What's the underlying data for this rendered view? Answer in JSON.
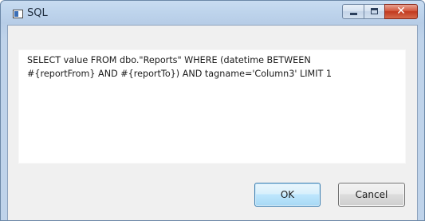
{
  "window": {
    "title": "SQL"
  },
  "editor": {
    "sql_text": "SELECT value FROM dbo.\"Reports\" WHERE (datetime BETWEEN\n#{reportFrom} AND #{reportTo}) AND tagname='Column3' LIMIT 1"
  },
  "buttons": {
    "ok_label": "OK",
    "cancel_label": "Cancel"
  },
  "icons": {
    "app": "window-icon",
    "minimize": "minimize-icon",
    "maximize": "maximize-icon",
    "close": "close-icon"
  },
  "colors": {
    "titlebar": "#bfd3ea",
    "close_button": "#c2391f",
    "ok_button_border": "#3c7fb1",
    "dialog_background": "#f0f0f0"
  }
}
